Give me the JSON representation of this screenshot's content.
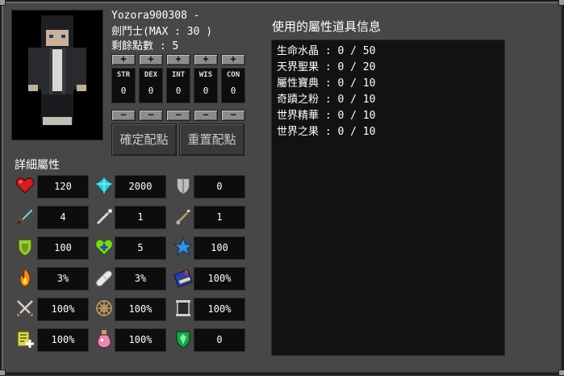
{
  "character": {
    "name_line": "Yozora900308 -",
    "class_line": "劍鬥士(MAX : 30 )",
    "points_line": "剩餘點數 : 5"
  },
  "stats": [
    {
      "key": "STR",
      "value": "0"
    },
    {
      "key": "DEX",
      "value": "0"
    },
    {
      "key": "INT",
      "value": "0"
    },
    {
      "key": "WIS",
      "value": "0"
    },
    {
      "key": "CON",
      "value": "0"
    }
  ],
  "buttons": {
    "plus": "+",
    "minus": "−",
    "confirm": "確定配點",
    "reset": "重置配點"
  },
  "details": {
    "title": "詳細屬性",
    "rows": [
      [
        {
          "icon": "heart-icon",
          "value": "120"
        },
        {
          "icon": "diamond-icon",
          "value": "2000"
        },
        {
          "icon": "shield-icon",
          "value": "0"
        }
      ],
      [
        {
          "icon": "sword-icon",
          "value": "4"
        },
        {
          "icon": "wand-icon",
          "value": "1"
        },
        {
          "icon": "arrow-icon",
          "value": "1"
        }
      ],
      [
        {
          "icon": "green-shield-icon",
          "value": "100"
        },
        {
          "icon": "green-heart-plus-icon",
          "value": "5"
        },
        {
          "icon": "blue-star-icon",
          "value": "100"
        }
      ],
      [
        {
          "icon": "fire-icon",
          "value": "3%"
        },
        {
          "icon": "bandage-icon",
          "value": "3%"
        },
        {
          "icon": "spellbook-icon",
          "value": "100%"
        }
      ],
      [
        {
          "icon": "crossed-swords-icon",
          "value": "100%"
        },
        {
          "icon": "web-icon",
          "value": "100%"
        },
        {
          "icon": "scroll-icon",
          "value": "100%"
        }
      ],
      [
        {
          "icon": "exp-plus-icon",
          "value": "100%"
        },
        {
          "icon": "potion-icon",
          "value": "100%"
        },
        {
          "icon": "emerald-shield-icon",
          "value": "0"
        }
      ]
    ]
  },
  "items_panel": {
    "title": "使用的屬性道具信息",
    "items": [
      "生命水晶 : 0 / 50",
      "天界聖果 : 0 / 20",
      "屬性寶典 : 0 / 10",
      "奇蹟之粉 : 0 / 10",
      "世界精華 : 0 / 10",
      "世界之果 : 0 / 10"
    ]
  },
  "colors": {
    "panel_bg": "#474747",
    "dark_box": "#0d0d0d",
    "button_gray": "#8c8c8c"
  }
}
